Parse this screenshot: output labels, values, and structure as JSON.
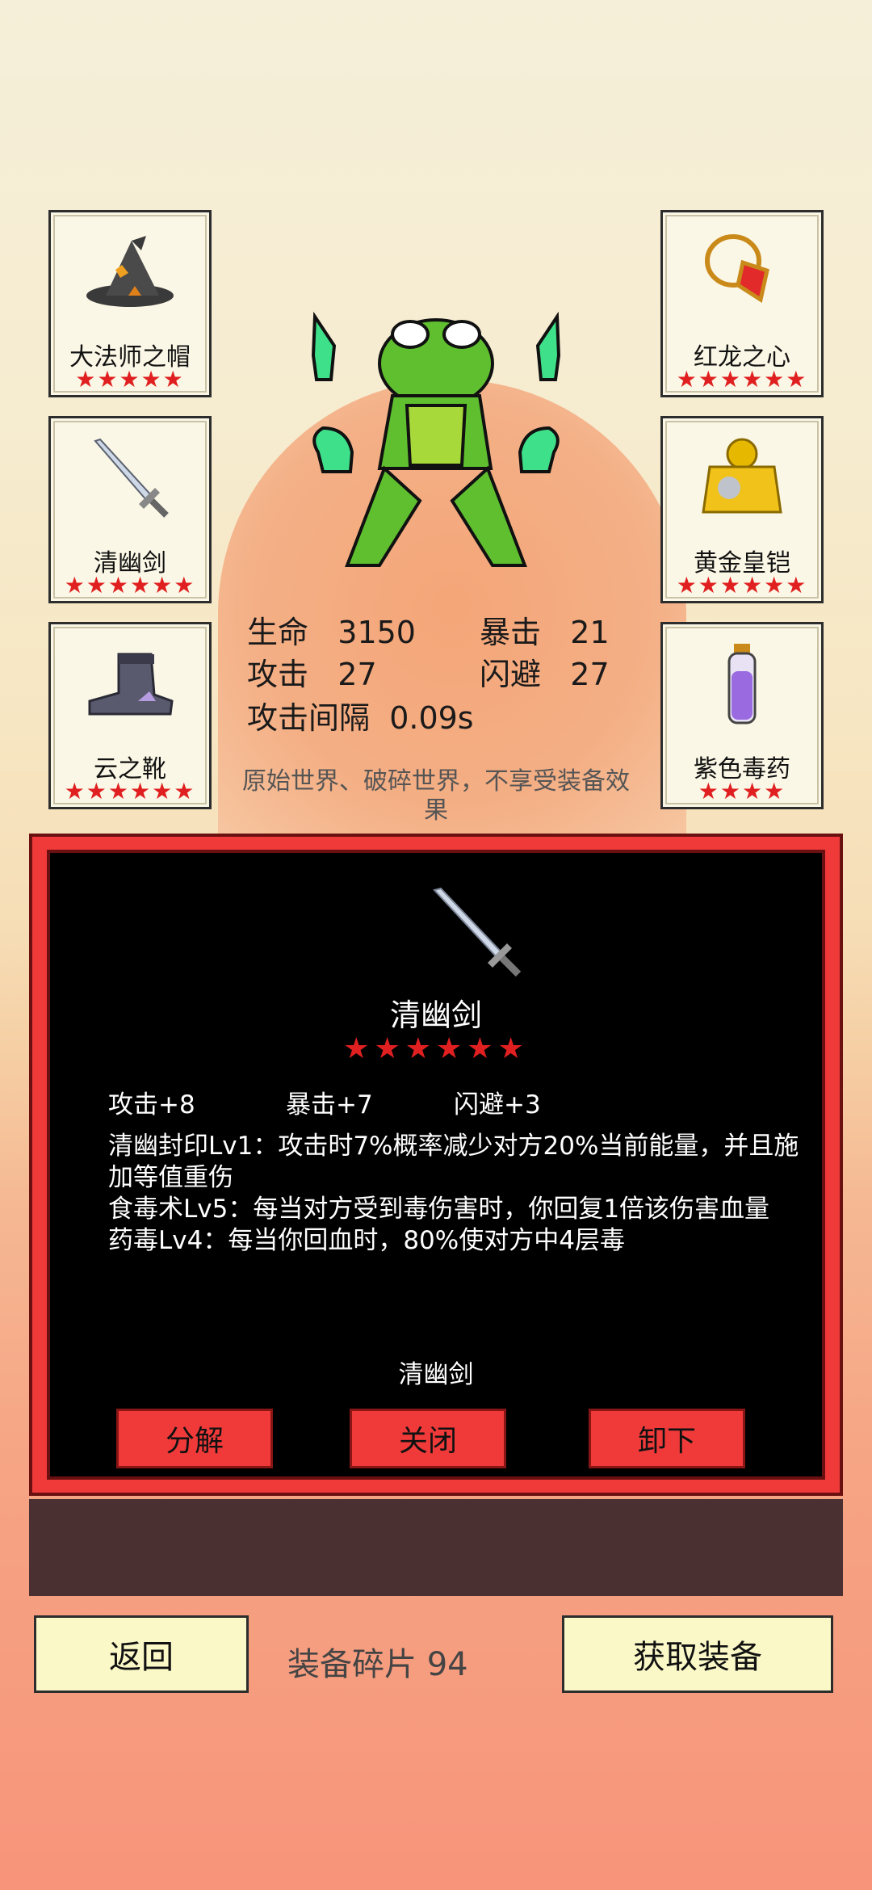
{
  "equipment_left": [
    {
      "name": "大法师之帽",
      "stars": "★★★★★",
      "icon": "wizard-hat-icon"
    },
    {
      "name": "清幽剑",
      "stars": "★★★★★★",
      "icon": "sword-icon"
    },
    {
      "name": "云之靴",
      "stars": "★★★★★★",
      "icon": "boot-icon"
    }
  ],
  "equipment_right": [
    {
      "name": "红龙之心",
      "stars": "★★★★★★",
      "icon": "amulet-icon"
    },
    {
      "name": "黄金皇铠",
      "stars": "★★★★★★",
      "icon": "gold-armor-icon"
    },
    {
      "name": "紫色毒药",
      "stars": "★★★★",
      "icon": "potion-icon"
    }
  ],
  "stats": {
    "hp_label": "生命",
    "hp_value": "3150",
    "crit_label": "暴击",
    "crit_value": "21",
    "atk_label": "攻击",
    "atk_value": "27",
    "dodge_label": "闪避",
    "dodge_value": "27",
    "interval_label": "攻击间隔",
    "interval_value": "0.09s"
  },
  "note": "原始世界、破碎世界，不享受装备效果",
  "dialog": {
    "title": "清幽剑",
    "stars": "★★★★★★",
    "attrs": [
      "攻击+8",
      "暴击+7",
      "闪避+3"
    ],
    "desc": [
      "清幽封印Lv1：攻击时7%概率减少对方20%当前能量，并且施加等值重伤",
      "食毒术Lv5：每当对方受到毒伤害时，你回复1倍该伤害血量",
      "药毒Lv4：每当你回血时，80%使对方中4层毒"
    ],
    "footer": "清幽剑",
    "buttons": {
      "decompose": "分解",
      "close": "关闭",
      "unequip": "卸下"
    }
  },
  "bottom": {
    "back": "返回",
    "shards_label": "装备碎片",
    "shards_value": "94",
    "get_equipment": "获取装备"
  },
  "colors": {
    "star": "#e02020",
    "dialog_border": "#f03a3a",
    "button_bg": "#fbf8c8"
  }
}
